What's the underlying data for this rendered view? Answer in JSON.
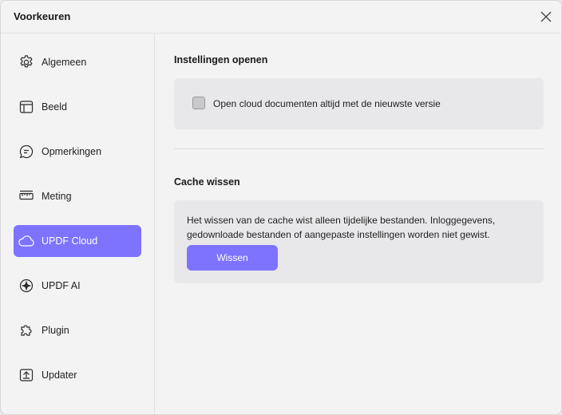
{
  "window": {
    "title": "Voorkeuren"
  },
  "sidebar": {
    "items": [
      {
        "label": "Algemeen",
        "icon": "gear-icon"
      },
      {
        "label": "Beeld",
        "icon": "layout-icon"
      },
      {
        "label": "Opmerkingen",
        "icon": "comment-icon"
      },
      {
        "label": "Meting",
        "icon": "ruler-icon"
      },
      {
        "label": "UPDF Cloud",
        "icon": "cloud-icon",
        "active": true
      },
      {
        "label": "UPDF AI",
        "icon": "ai-sparkle-icon"
      },
      {
        "label": "Plugin",
        "icon": "puzzle-icon"
      },
      {
        "label": "Updater",
        "icon": "update-icon"
      }
    ]
  },
  "main": {
    "open_settings": {
      "title": "Instellingen openen",
      "checkbox_label": "Open cloud documenten altijd met de nieuwste versie",
      "checked": false
    },
    "cache": {
      "title": "Cache wissen",
      "description": "Het wissen van de cache wist alleen tijdelijke bestanden. Inloggegevens, gedownloade bestanden of aangepaste instellingen worden niet gewist.",
      "button_label": "Wissen"
    }
  },
  "colors": {
    "accent": "#7d73ff",
    "card": "#e8e8ea",
    "background": "#f3f3f4"
  }
}
